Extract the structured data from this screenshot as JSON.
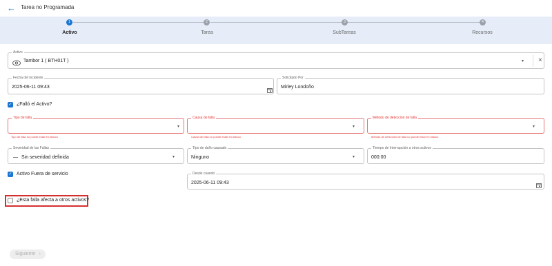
{
  "header": {
    "title": "Tarea no Programada",
    "back_icon": "arrow-left-icon"
  },
  "stepper": {
    "steps": [
      {
        "number": "1",
        "label": "Activo",
        "active": true
      },
      {
        "number": "2",
        "label": "Tarea",
        "active": false
      },
      {
        "number": "3",
        "label": "SubTareas",
        "active": false
      },
      {
        "number": "4",
        "label": "Recursos",
        "active": false
      }
    ]
  },
  "form": {
    "activo": {
      "label": "Activo",
      "value": "Tambor 1     ( BTH01T )"
    },
    "fecha": {
      "label": "Fecha del incidente",
      "value": "2025-06-11 09:43"
    },
    "solicitado": {
      "label": "Solicitado Por",
      "value": "Mirley Londoño"
    },
    "fallo_checkbox": {
      "label": "¿Falló el Activo?",
      "checked": true
    },
    "tipo_falla": {
      "label": "Tipo de falla",
      "value": "",
      "helper": "Tipo de falla no puede estar en blanco"
    },
    "causa_falla": {
      "label": "Causa de falla",
      "value": "",
      "helper": "Causa de falla no puede estar en blanco"
    },
    "metodo_deteccion": {
      "label": "Método de detección de falla",
      "value": "",
      "helper": "Método de detección de falla no puede estar en blanco"
    },
    "severidad": {
      "label": "Severidad de las Fallas",
      "value": "Sin severidad definida",
      "prefix": "—"
    },
    "tipo_dano": {
      "label": "Tipo de daño causado",
      "value": "Ninguno"
    },
    "tiempo_interrupcion": {
      "label": "Tiempo de Interrupción a otros activos",
      "value": "000:00"
    },
    "fuera_servicio": {
      "label": "Activo Fuera de servicio",
      "checked": true
    },
    "desde_cuando": {
      "label": "Desde cuando",
      "value": "2025-06-11 09:43"
    },
    "afecta_otros": {
      "label": "¿Esta falla afecta a otros activos?",
      "checked": false
    }
  },
  "footer": {
    "next_label": "Siguiente",
    "next_icon": "chevron-right-icon"
  }
}
